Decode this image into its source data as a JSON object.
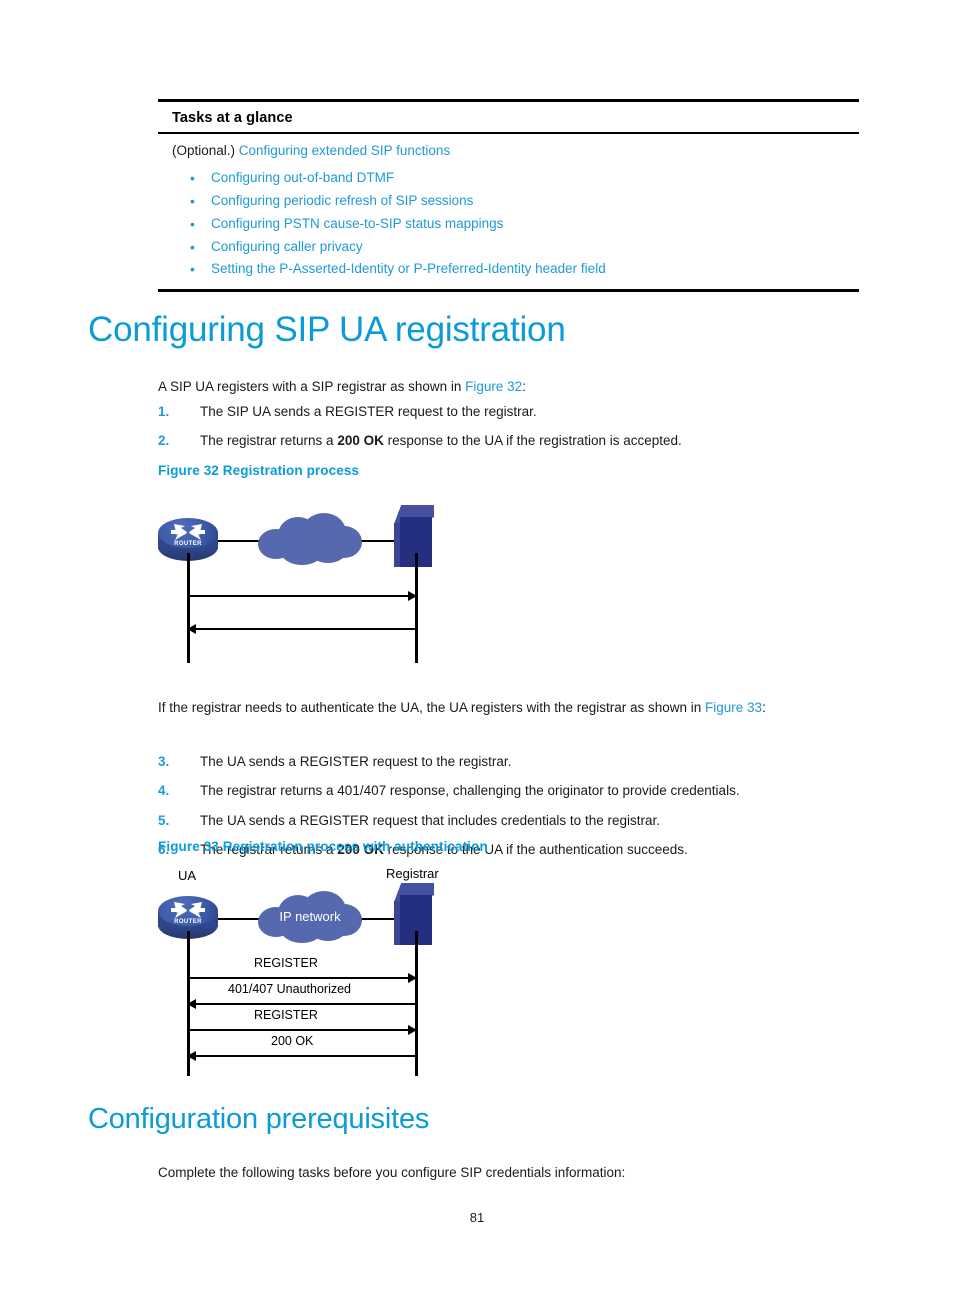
{
  "tasks_table": {
    "header": "Tasks at a glance",
    "optional_prefix": "(Optional.)",
    "optional_link": "Configuring extended SIP functions",
    "items": [
      "Configuring out-of-band DTMF",
      "Configuring periodic refresh of SIP sessions",
      "Configuring PSTN cause-to-SIP status mappings",
      "Configuring caller privacy",
      "Setting the P-Asserted-Identity or P-Preferred-Identity header field"
    ],
    "bullet_glyph": "•"
  },
  "headings": {
    "sip_registration": "Configuring SIP UA registration",
    "prerequisites": "Configuration prerequisites"
  },
  "intro_1": {
    "before_link": "A SIP UA registers with a SIP registrar as shown in ",
    "link": "Figure 32",
    "after_link": ":"
  },
  "steps_1": [
    {
      "num": "1.",
      "text": "The SIP UA sends a REGISTER request to the registrar."
    },
    {
      "num": "2.",
      "before_bold": "The registrar returns a ",
      "bold": "200 OK",
      "after_bold": " response to the UA if the registration is accepted."
    }
  ],
  "figure32": {
    "caption": "Figure 32 Registration process",
    "router_label": "ROUTER",
    "icons": {
      "router": "router-icon",
      "cloud": "cloud-icon",
      "server": "server-icon"
    }
  },
  "intro_2": {
    "before_link": "If the registrar needs to authenticate the UA, the UA registers with the registrar as shown in ",
    "link": "Figure 33",
    "after_link": ":"
  },
  "steps_2": [
    {
      "num": "3.",
      "text": "The UA sends a REGISTER request to the registrar."
    },
    {
      "num": "4.",
      "text": "The registrar returns a 401/407 response, challenging the originator to provide credentials."
    },
    {
      "num": "5.",
      "text": "The UA sends a REGISTER request that includes credentials to the registrar."
    },
    {
      "num": "6.",
      "before_bold": "The registrar returns a ",
      "bold": "200 OK",
      "after_bold": " response to the UA if the authentication succeeds."
    }
  ],
  "figure33": {
    "caption": "Figure 33 Registration process with authentication",
    "ua_label": "UA",
    "registrar_label": "Registrar",
    "cloud_label": "IP network",
    "router_label": "ROUTER",
    "messages": [
      "REGISTER",
      "401/407 Unauthorized",
      "REGISTER",
      "200 OK"
    ]
  },
  "prereq_para": "Complete the following tasks before you configure SIP credentials information:",
  "page_number": "81",
  "colors": {
    "accent_blue": "#0b9bd7",
    "link_blue": "#1e9ad6",
    "cloud_blue": "#5668ae",
    "router_blue": "#3b59a6",
    "server_blue": "#252f7f",
    "text_black": "#1a1a1a"
  }
}
